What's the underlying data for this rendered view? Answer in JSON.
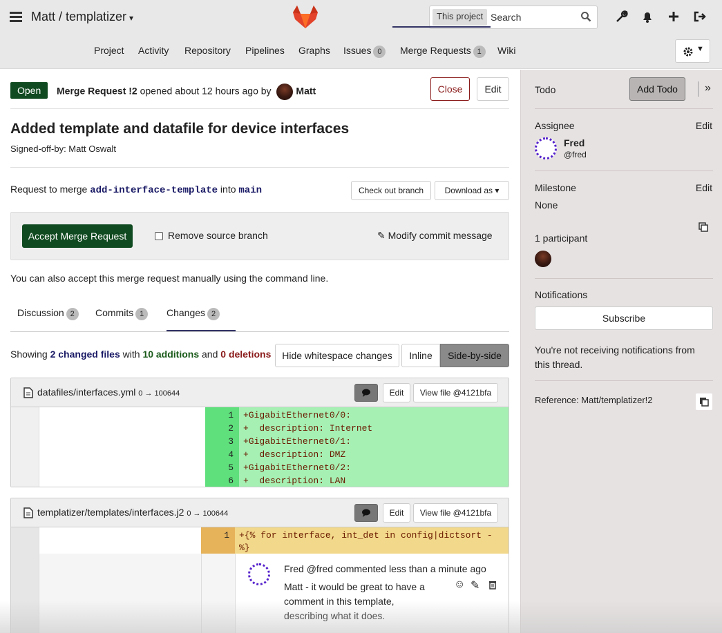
{
  "header": {
    "project_title": "Matt / templatizer",
    "search_scope": "This project",
    "search_placeholder": "Search"
  },
  "nav": {
    "tabs": [
      {
        "label": "Project"
      },
      {
        "label": "Activity"
      },
      {
        "label": "Repository"
      },
      {
        "label": "Pipelines"
      },
      {
        "label": "Graphs"
      },
      {
        "label": "Issues",
        "count": "0"
      },
      {
        "label": "Merge Requests",
        "count": "1"
      },
      {
        "label": "Wiki"
      }
    ]
  },
  "mr": {
    "status": "Open",
    "title_prefix": "Merge Request !2",
    "opened_text": "opened about 12 hours ago by",
    "author": "Matt",
    "close_label": "Close",
    "edit_label": "Edit",
    "title": "Added template and datafile for device interfaces",
    "signed_off": "Signed-off-by: Matt Oswalt",
    "merge_text_1": "Request to merge",
    "source_branch": "add-interface-template",
    "merge_text_2": "into",
    "target_branch": "main",
    "checkout_label": "Check out branch",
    "download_label": "Download as",
    "accept_label": "Accept Merge Request",
    "remove_source_label": "Remove source branch",
    "modify_commit_label": "Modify commit message",
    "also_accept_text": "You can also accept this merge request manually using the",
    "command_line": "command line",
    "period": "."
  },
  "subtabs": [
    {
      "label": "Discussion",
      "count": "2"
    },
    {
      "label": "Commits",
      "count": "1"
    },
    {
      "label": "Changes",
      "count": "2"
    }
  ],
  "diff_summary": {
    "showing": "Showing",
    "changed_files": "2 changed files",
    "with": "with",
    "additions": "10 additions",
    "and": "and",
    "deletions": "0 deletions",
    "hide_ws_label": "Hide whitespace changes",
    "inline_label": "Inline",
    "side_label": "Side-by-side"
  },
  "files": [
    {
      "name": "datafiles/interfaces.yml",
      "mode": "0 → 100644",
      "edit_label": "Edit",
      "view_label": "View file @4121bfa",
      "lines": [
        {
          "num": "1",
          "code": "+GigabitEthernet0/0:"
        },
        {
          "num": "2",
          "code": "+  description: Internet"
        },
        {
          "num": "3",
          "code": "+GigabitEthernet0/1:"
        },
        {
          "num": "4",
          "code": "+  description: DMZ"
        },
        {
          "num": "5",
          "code": "+GigabitEthernet0/2:"
        },
        {
          "num": "6",
          "code": "+  description: LAN"
        }
      ]
    },
    {
      "name": "templatizer/templates/interfaces.j2",
      "mode": "0 → 100644",
      "edit_label": "Edit",
      "view_label": "View file @4121bfa",
      "lines": [
        {
          "num": "1",
          "code_a": "+{% for interface, int_det in config|dictsort -",
          "code_b": "%}"
        }
      ],
      "comment": {
        "author": "Fred",
        "handle": "@fred",
        "when": "commented less than a minute ago",
        "body_1": "Matt - it would be great to have a",
        "body_2": "comment in this template,",
        "body_3": "describing what it does."
      }
    }
  ],
  "sidebar": {
    "todo_label": "Todo",
    "add_todo_label": "Add Todo",
    "assignee_label": "Assignee",
    "edit_label": "Edit",
    "assignee_name": "Fred",
    "assignee_handle": "@fred",
    "milestone_label": "Milestone",
    "milestone_value": "None",
    "participants_label": "1 participant",
    "notifications_label": "Notifications",
    "subscribe_label": "Subscribe",
    "not_receiving_1": "You're not receiving notifications from",
    "not_receiving_2": "this thread.",
    "reference_label": "Reference: Matt/templatizer!2"
  },
  "colors": {
    "accent_green": "#104a20",
    "close_red": "#8a1a1a",
    "add_line": "#a6f0b4",
    "add_num": "#5fe07c",
    "mod_line": "#f2d88a",
    "mod_num": "#e6b25a",
    "sidebar_bg": "#e7e2e2",
    "fred_avatar": "#5522cc"
  }
}
